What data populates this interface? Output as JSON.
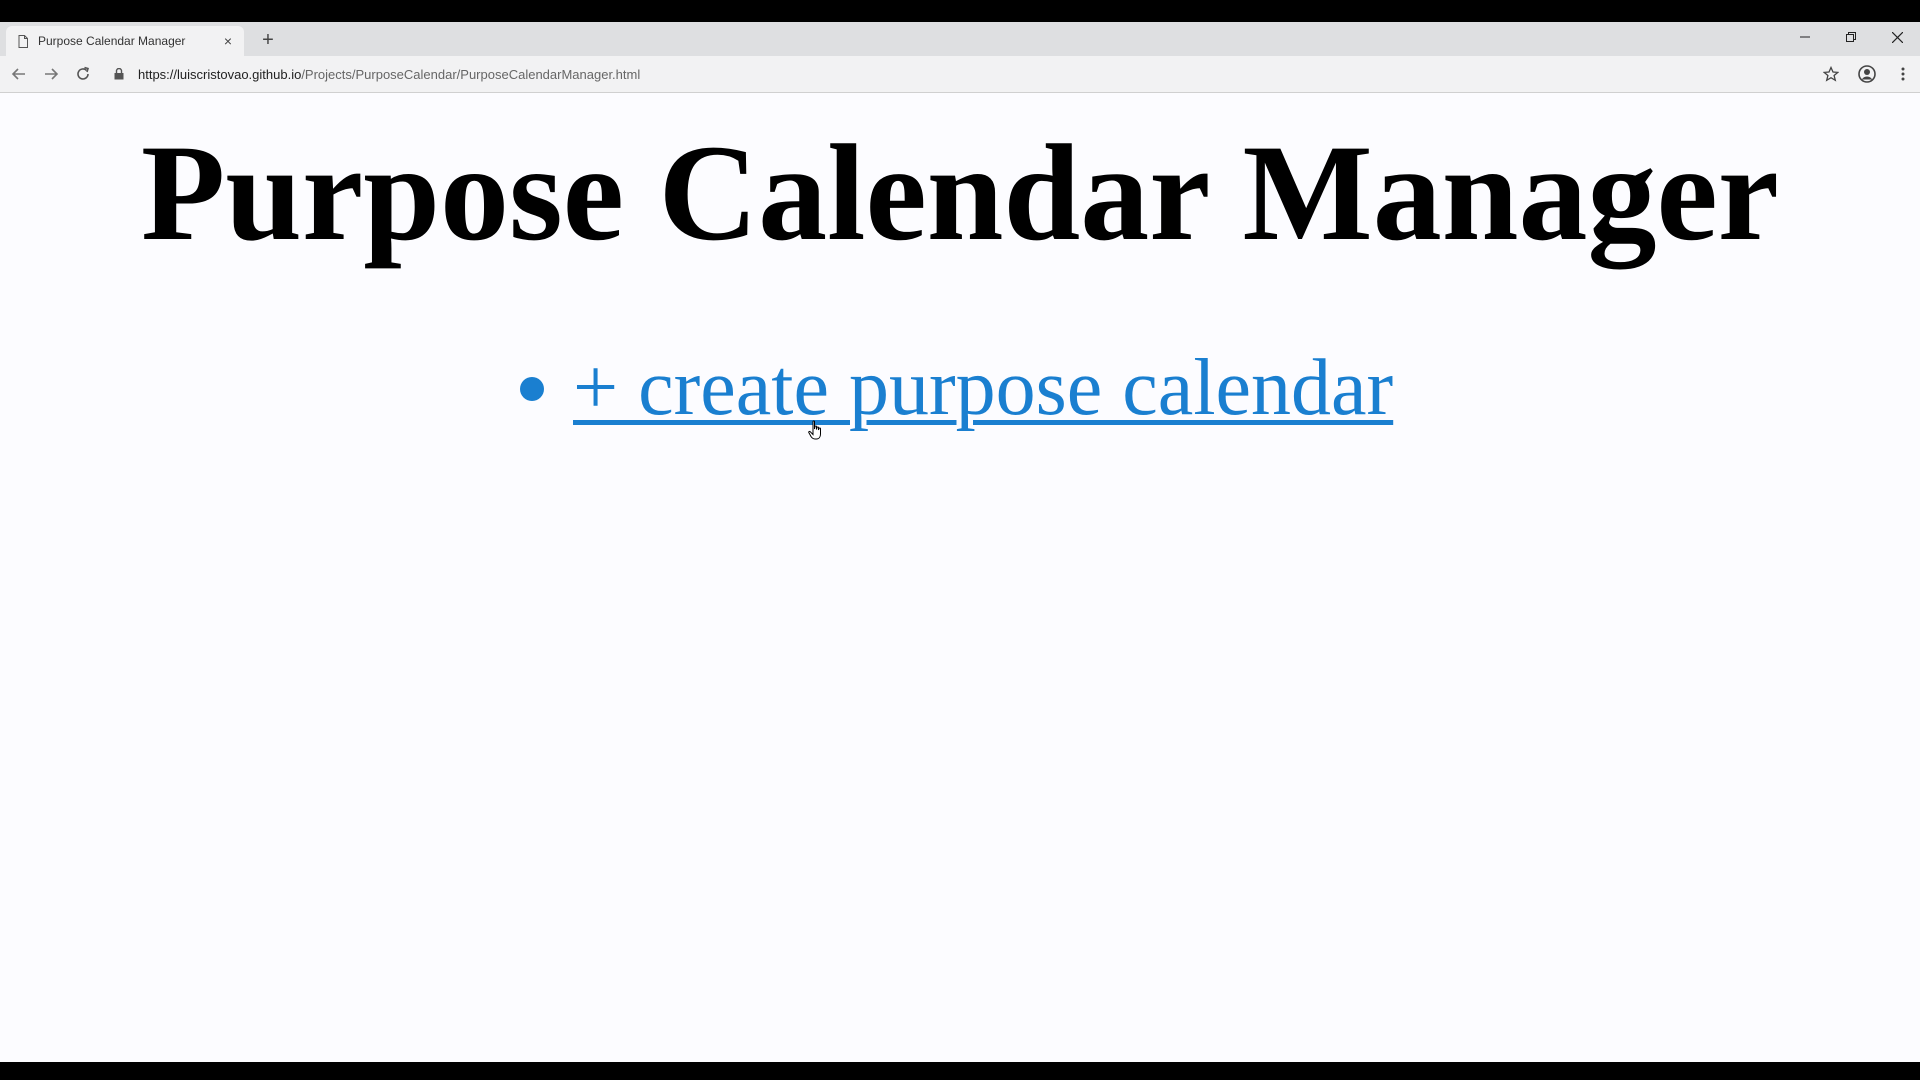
{
  "browser": {
    "tab": {
      "title": "Purpose Calendar Manager",
      "favicon": "page-icon",
      "close_label": "×"
    },
    "new_tab_label": "+",
    "window_controls": {
      "minimize_label": "–",
      "restore_label": "❐",
      "close_label": "✕"
    },
    "address": {
      "host": "https://luiscristovao.github.io",
      "path": "/Projects/PurposeCalendar/PurposeCalendarManager.html"
    }
  },
  "page": {
    "title": "Purpose Calendar Manager",
    "items": [
      {
        "label": "+ create purpose calendar"
      }
    ]
  },
  "colors": {
    "link": "#1a7fd0",
    "background": "#fcfcff",
    "tabstrip": "#dedfe1",
    "toolbar": "#f2f2f3"
  }
}
